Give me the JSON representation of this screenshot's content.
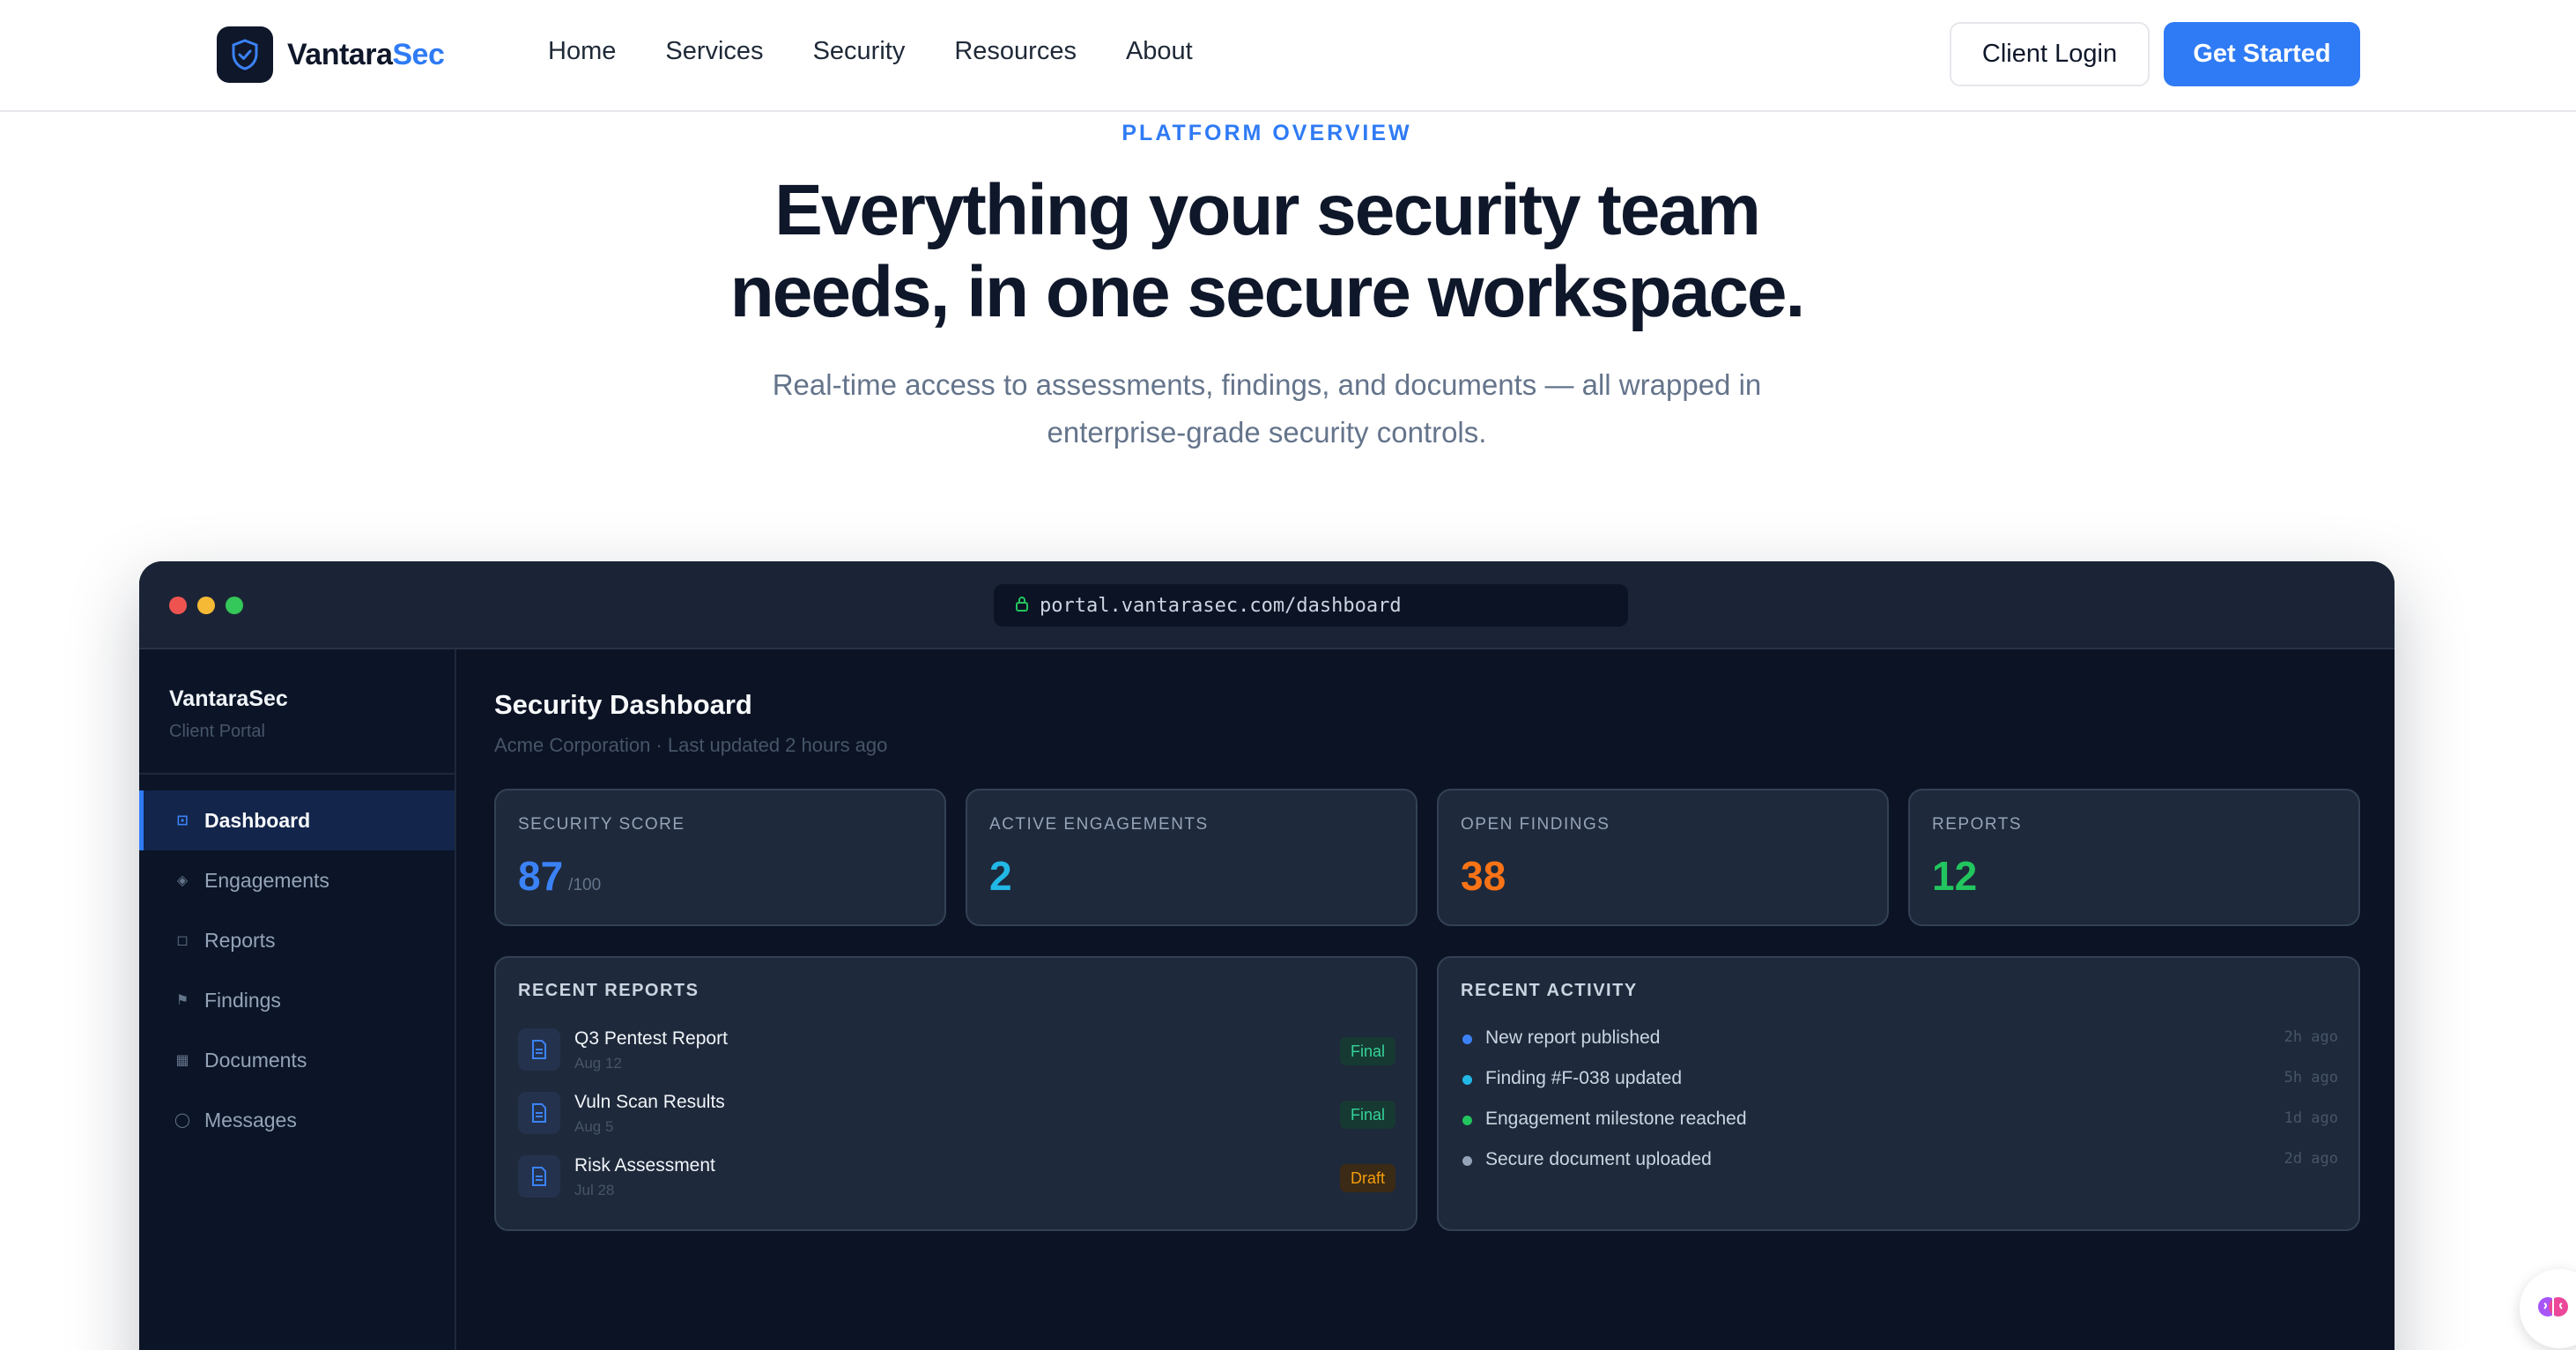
{
  "nav": {
    "brand_part1": "Vantara",
    "brand_part2": "Sec",
    "links": [
      "Home",
      "Services",
      "Security",
      "Resources",
      "About"
    ],
    "login_label": "Client Login",
    "start_label": "Get Started",
    "accent_color": "#2f7bf5"
  },
  "hero": {
    "eyebrow": "PLATFORM OVERVIEW",
    "title_line1": "Everything your security team",
    "title_line2": "needs, in one secure workspace.",
    "sub_line1": "Real-time access to assessments, findings, and documents — all wrapped in",
    "sub_line2": "enterprise-grade security controls."
  },
  "browser": {
    "url": "portal.vantarasec.com/dashboard"
  },
  "sidebar": {
    "brand": "VantaraSec",
    "sub": "Client Portal",
    "items": [
      {
        "label": "Dashboard",
        "icon": "grid-icon",
        "glyph": "⊡"
      },
      {
        "label": "Engagements",
        "icon": "diamond-icon",
        "glyph": "◈"
      },
      {
        "label": "Reports",
        "icon": "square-icon",
        "glyph": "◻"
      },
      {
        "label": "Findings",
        "icon": "flag-icon",
        "glyph": "⚑"
      },
      {
        "label": "Documents",
        "icon": "file-icon",
        "glyph": "▦"
      },
      {
        "label": "Messages",
        "icon": "chat-icon",
        "glyph": "◯"
      }
    ]
  },
  "dashboard": {
    "title": "Security Dashboard",
    "subtitle": "Acme Corporation · Last updated 2 hours ago",
    "stats": [
      {
        "label": "SECURITY SCORE",
        "value": "87",
        "suffix": "/100",
        "color": "#3b82f6"
      },
      {
        "label": "ACTIVE ENGAGEMENTS",
        "value": "2",
        "suffix": "",
        "color": "#22b8e6"
      },
      {
        "label": "OPEN FINDINGS",
        "value": "38",
        "suffix": "",
        "color": "#f97316"
      },
      {
        "label": "REPORTS",
        "value": "12",
        "suffix": "",
        "color": "#22c55e"
      }
    ],
    "reports_title": "RECENT REPORTS",
    "reports": [
      {
        "name": "Q3 Pentest Report",
        "date": "Aug 12",
        "status": "Final"
      },
      {
        "name": "Vuln Scan Results",
        "date": "Aug 5",
        "status": "Final"
      },
      {
        "name": "Risk Assessment",
        "date": "Jul 28",
        "status": "Draft"
      }
    ],
    "activity_title": "RECENT ACTIVITY",
    "activity": [
      {
        "text": "New report published",
        "time": "2h ago",
        "color": "#3b82f6"
      },
      {
        "text": "Finding #F-038 updated",
        "time": "5h ago",
        "color": "#22b8e6"
      },
      {
        "text": "Engagement milestone reached",
        "time": "1d ago",
        "color": "#22c55e"
      },
      {
        "text": "Secure document uploaded",
        "time": "2d ago",
        "color": "#94a3b8"
      }
    ]
  }
}
